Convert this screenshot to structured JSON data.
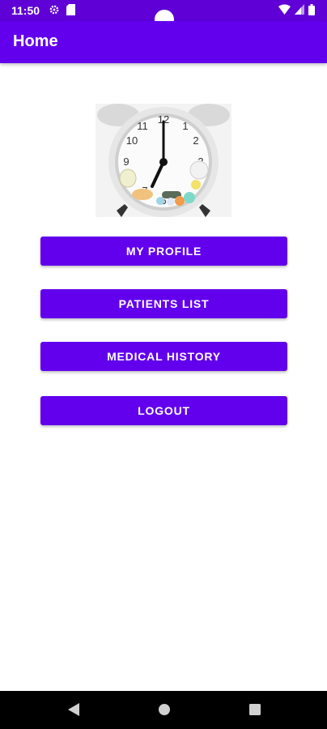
{
  "status_bar": {
    "time": "11:50",
    "icons": [
      "gear-icon",
      "sim-card-icon",
      "wifi-icon",
      "signal-icon",
      "battery-icon"
    ]
  },
  "app_bar": {
    "title": "Home",
    "color": "#6200ee"
  },
  "hero_image": {
    "description_icon": "alarm-clock-with-pills-image"
  },
  "buttons": {
    "my_profile": "MY PROFILE",
    "patients_list": "PATIENTS LIST",
    "medical_history": "MEDICAL HISTORY",
    "logout": "LOGOUT"
  },
  "nav_bar": {
    "icons": [
      "back-icon",
      "home-icon",
      "recents-icon"
    ]
  }
}
